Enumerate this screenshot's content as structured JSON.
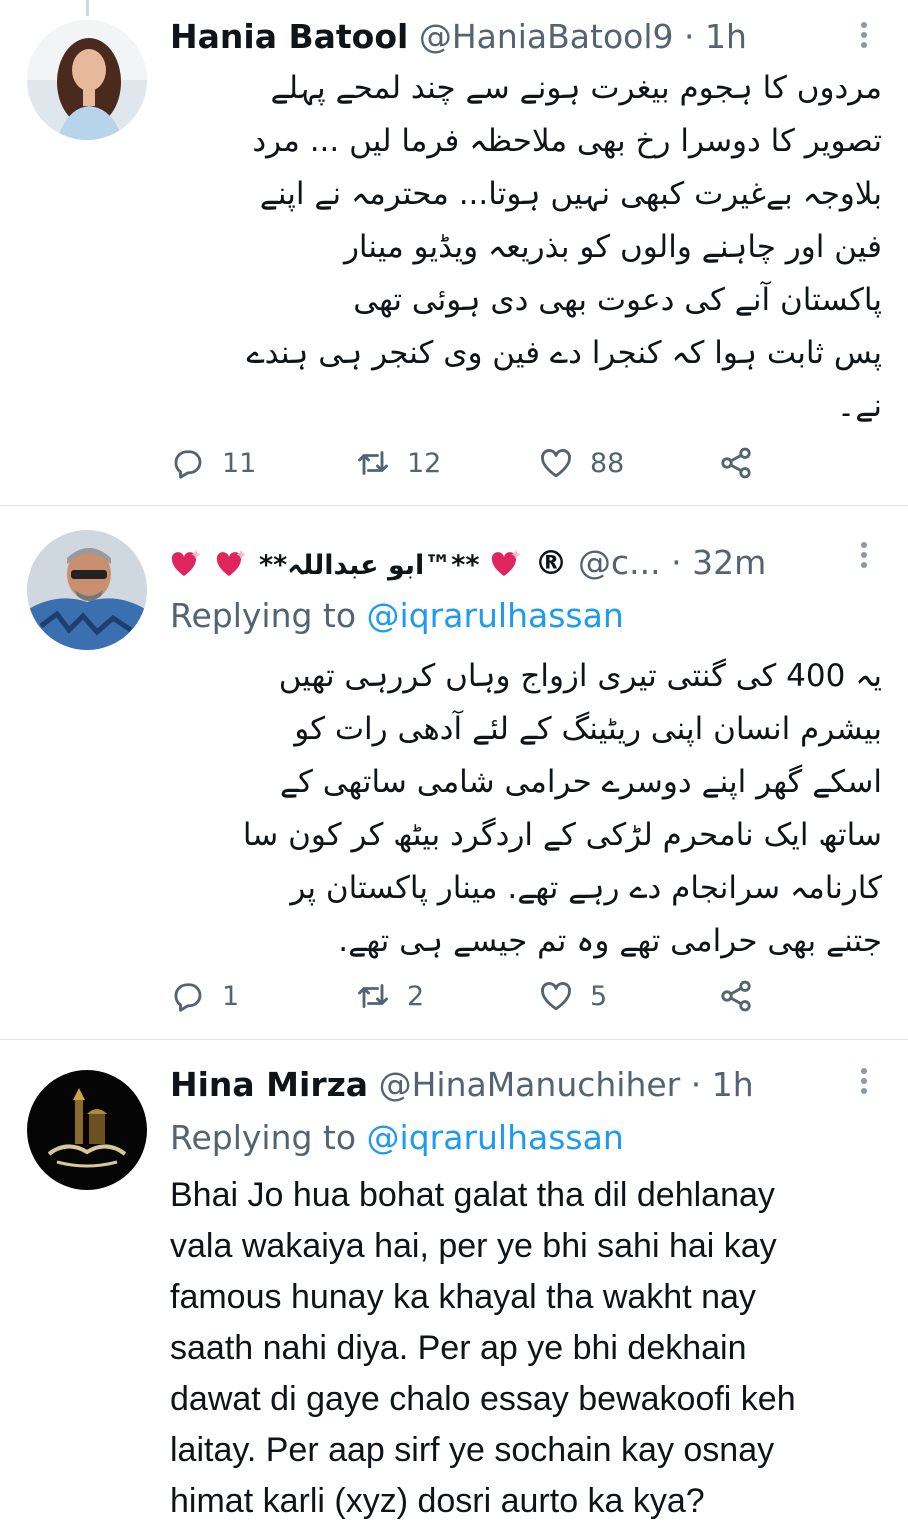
{
  "tweets": [
    {
      "name": "Hania Batool",
      "handle": "@HaniaBatool9",
      "separator": "·",
      "time": "1h",
      "body_lines": [
        "مردوں کا ہجوم بیغرت ہونے سے چند لمحے پہلے",
        "تصویر کا دوسرا رخ بھی ملاحظہ فرما لیں ... مرد",
        "بلاوجہ بےغیرت کبھی نہیں ہوتا... محترمہ نے اپنے",
        "فین اور چاہنے والوں کو بذریعہ ویڈیو مینار",
        "پاکستان آنے کی دعوت بھی دی ہوئی تھی",
        "پس ثابت ہوا کہ کنجرا دے فین وی کنجر ہی ہندے",
        "نے۔"
      ],
      "stats": {
        "replies": "11",
        "retweets": "12",
        "likes": "88"
      },
      "icons": {
        "reply": "reply-icon",
        "retweet": "retweet-icon",
        "like": "heart-icon",
        "share": "share-icon",
        "more": "more-icon"
      }
    },
    {
      "name": "**ابو عبداللہ™**",
      "name_suffix": "®",
      "handle": "@c...",
      "separator": "·",
      "time": "32m",
      "replying_label": "Replying to",
      "replying_to": "@iqrarulhassan",
      "body_lines": [
        "یہ 400 کی گنتی تیری ازواج وہاں کررہی تھیں",
        "بیشرم انسان اپنی ریٹینگ کے لئے آدھی رات کو",
        "اسکے گھر اپنے دوسرے حرامی شامی ساتھی کے",
        "ساتھ ایک نامحرم لڑکی کے اردگرد بیٹھ کر کون سا",
        "کارنامہ سرانجام دے رہے تھے. مینار پاکستان پر",
        "جتنے بھی حرامی تھے وہ تم جیسے ہی تھے."
      ],
      "stats": {
        "replies": "1",
        "retweets": "2",
        "likes": "5"
      }
    },
    {
      "name": "Hina Mirza",
      "handle": "@HinaManuchiher",
      "separator": "·",
      "time": "1h",
      "replying_label": "Replying to",
      "replying_to": "@iqrarulhassan",
      "body_lines": [
        "Bhai Jo hua bohat galat tha dil dehlanay",
        "vala wakaiya hai, per ye bhi sahi hai kay",
        "famous hunay ka khayal tha wakht nay",
        "saath nahi diya. Per ap ye bhi dekhain",
        "dawat di gaye chalo essay bewakoofi keh",
        "laitay. Per aap sirf ye sochain kay osnay",
        "himat karli (xyz) dosri aurto ka kya?"
      ]
    }
  ],
  "colors": {
    "text": "#0f1419",
    "secondary": "#536471",
    "link": "#1d9bf0",
    "divider": "#e1e6ea",
    "heart_emoji": "#e0245e"
  }
}
